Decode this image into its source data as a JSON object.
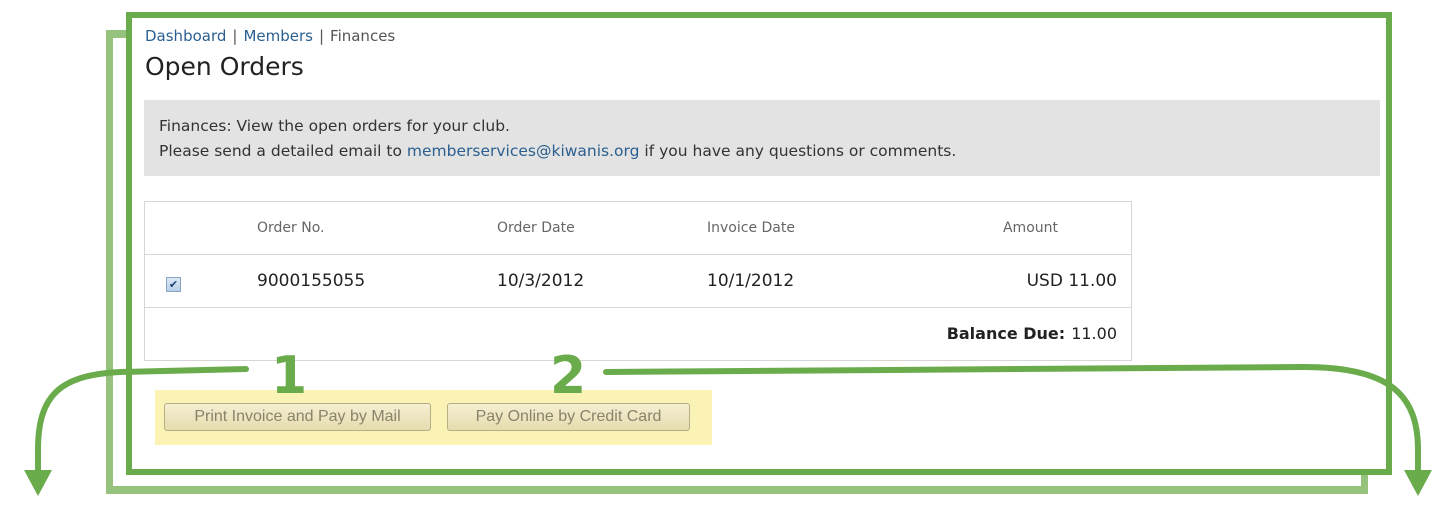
{
  "breadcrumb": {
    "items": [
      "Dashboard",
      "Members",
      "Finances"
    ],
    "separator": "|"
  },
  "page": {
    "title": "Open Orders"
  },
  "info": {
    "line1": "Finances: View the open orders for your club.",
    "line2_prefix": "Please send a detailed email to ",
    "email": "memberservices@kiwanis.org",
    "line2_suffix": " if you have any questions or comments."
  },
  "table": {
    "headers": [
      "Order No.",
      "Order Date",
      "Invoice Date",
      "Amount"
    ],
    "rows": [
      {
        "checked": true,
        "order_no": "9000155055",
        "order_date": "10/3/2012",
        "invoice_date": "10/1/2012",
        "amount": "USD 11.00"
      }
    ],
    "balance_label": "Balance Due:",
    "balance_value": "11.00"
  },
  "buttons": {
    "print": "Print Invoice and Pay by Mail",
    "pay_online": "Pay Online by Credit Card"
  },
  "annotations": {
    "one": "1",
    "two": "2"
  },
  "colors": {
    "accent_green": "#6aac4c",
    "highlight": "#fbf3b5",
    "link": "#2a5f8f"
  },
  "icons": {
    "checkbox": "checkbox-checked-icon",
    "arrows": "curved-arrow-icon"
  }
}
